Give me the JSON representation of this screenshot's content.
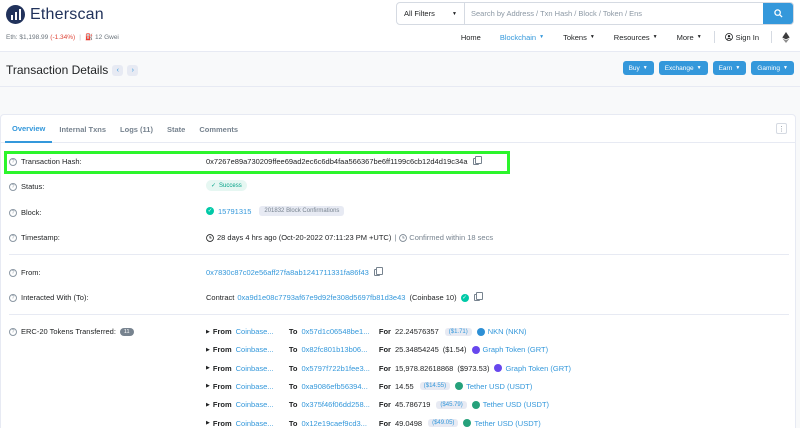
{
  "header": {
    "brand": "Etherscan",
    "eth_price_label": "Eth: $1,198.99",
    "eth_change": "(-1.34%)",
    "gas": "12 Gwei",
    "filter_label": "All Filters",
    "search_placeholder": "Search by Address / Txn Hash / Block / Token / Ens"
  },
  "nav": {
    "items": [
      "Home",
      "Blockchain",
      "Tokens",
      "Resources",
      "More"
    ],
    "sign_in": "Sign In"
  },
  "page": {
    "title": "Transaction Details",
    "actions": [
      "Buy",
      "Exchange",
      "Earn",
      "Gaming"
    ]
  },
  "tabs": [
    "Overview",
    "Internal Txns",
    "Logs (11)",
    "State",
    "Comments"
  ],
  "details": {
    "hash_label": "Transaction Hash:",
    "hash": "0x7267e89a730209ffee69ad2ec6c6db4faa566367be6ff1199c6cb12d4d19c34a",
    "status_label": "Status:",
    "status": "Success",
    "block_label": "Block:",
    "block": "15791315",
    "confirmations": "201832 Block Confirmations",
    "timestamp_label": "Timestamp:",
    "timestamp": "28 days 4 hrs ago (Oct-20-2022 07:11:23 PM +UTC)",
    "confirmed": "Confirmed within 18 secs",
    "from_label": "From:",
    "from": "0x7830c87c02e56aff27fa8ab1241711331fa86f43",
    "to_label": "Interacted With (To):",
    "contract_prefix": "Contract",
    "to": "0xa9d1e08c7793af67e9d92fe308d5697fb81d3e43",
    "to_name": "(Coinbase 10)",
    "erc20_label": "ERC-20 Tokens Transferred:",
    "erc20_count": "11"
  },
  "token_transfers": [
    {
      "from_word": "From",
      "from": "Coinbase...",
      "to_word": "To",
      "to": "0x57d1c06548be1...",
      "for_word": "For",
      "amount": "22.24576357",
      "usd": "($1.71)",
      "usd_badge": true,
      "token": "NKN (NKN)",
      "color": "#2d8fd5"
    },
    {
      "from_word": "From",
      "from": "Coinbase...",
      "to_word": "To",
      "to": "0x82fc801b13b06...",
      "for_word": "For",
      "amount": "25.34854245",
      "usd": "($1.54)",
      "usd_badge": false,
      "token": "Graph Token (GRT)",
      "color": "#6747ed"
    },
    {
      "from_word": "From",
      "from": "Coinbase...",
      "to_word": "To",
      "to": "0x5797f722b1fee3...",
      "for_word": "For",
      "amount": "15,978.82618868",
      "usd": "($973.53)",
      "usd_badge": false,
      "token": "Graph Token (GRT)",
      "color": "#6747ed"
    },
    {
      "from_word": "From",
      "from": "Coinbase...",
      "to_word": "To",
      "to": "0xa9086efb56394...",
      "for_word": "For",
      "amount": "14.55",
      "usd": "($14.55)",
      "usd_badge": true,
      "token": "Tether USD (USDT)",
      "color": "#26a17b"
    },
    {
      "from_word": "From",
      "from": "Coinbase...",
      "to_word": "To",
      "to": "0x375f46f06dd258...",
      "for_word": "For",
      "amount": "45.786719",
      "usd": "($45.79)",
      "usd_badge": true,
      "token": "Tether USD (USDT)",
      "color": "#26a17b"
    },
    {
      "from_word": "From",
      "from": "Coinbase...",
      "to_word": "To",
      "to": "0x12e19caef9cd3...",
      "for_word": "For",
      "amount": "49.0498",
      "usd": "($49.05)",
      "usd_badge": true,
      "token": "Tether USD (USDT)",
      "color": "#26a17b"
    }
  ],
  "colors": {
    "accent": "#3498db",
    "highlight": "#2cf52c",
    "success": "#00c9a7"
  }
}
